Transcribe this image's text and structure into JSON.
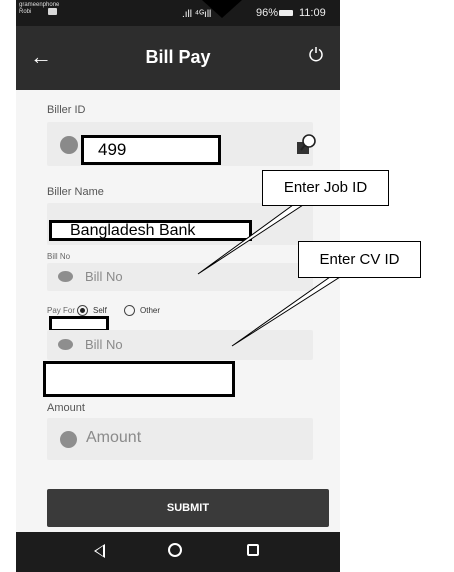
{
  "status_bar": {
    "carrier_line1": "grameenphone",
    "carrier_line2": "Robi",
    "signal": ".ıll ⁴ᴳıll",
    "battery": "96%",
    "time": "11:09"
  },
  "app_bar": {
    "title": "Bill Pay"
  },
  "form": {
    "biller_id_label": "Biller ID",
    "biller_id_value": "499",
    "biller_name_label": "Biller Name",
    "biller_name_value": "Bangladesh Bank",
    "bill_no_label": "Bill No",
    "bill_no_placeholder": "Bill No",
    "pay_for_label": "Pay For",
    "option_self": "Self",
    "option_other": "Other",
    "bill_no_placeholder_2": "Bill No",
    "amount_label": "Amount",
    "amount_placeholder": "Amount",
    "submit_label": "SUBMIT"
  },
  "annotations": {
    "callout_job": "Enter Job ID",
    "callout_cv": "Enter CV ID"
  },
  "colors": {
    "app_bar": "#2d2d2d",
    "background": "#f5f5f5",
    "submit": "#3a3a3a"
  }
}
